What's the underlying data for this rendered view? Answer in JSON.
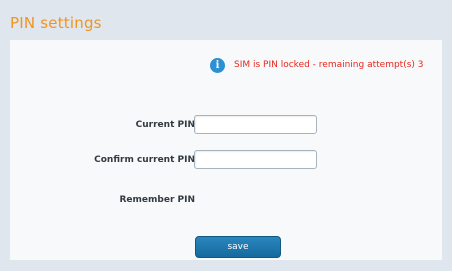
{
  "page": {
    "title": "PIN settings"
  },
  "alert": {
    "icon": "info-icon",
    "icon_glyph": "i",
    "message": "SIM is PIN locked - remaining attempt(s) 3"
  },
  "form": {
    "current_pin_label": "Current PIN",
    "current_pin_value": "",
    "confirm_pin_label": "Confirm current PIN",
    "confirm_pin_value": "",
    "remember_pin_label": "Remember PIN",
    "save_label": "save"
  },
  "colors": {
    "title": "#f29421",
    "alert_text": "#e8281e",
    "button": "#156a9e",
    "info_icon": "#2f8fd3"
  }
}
